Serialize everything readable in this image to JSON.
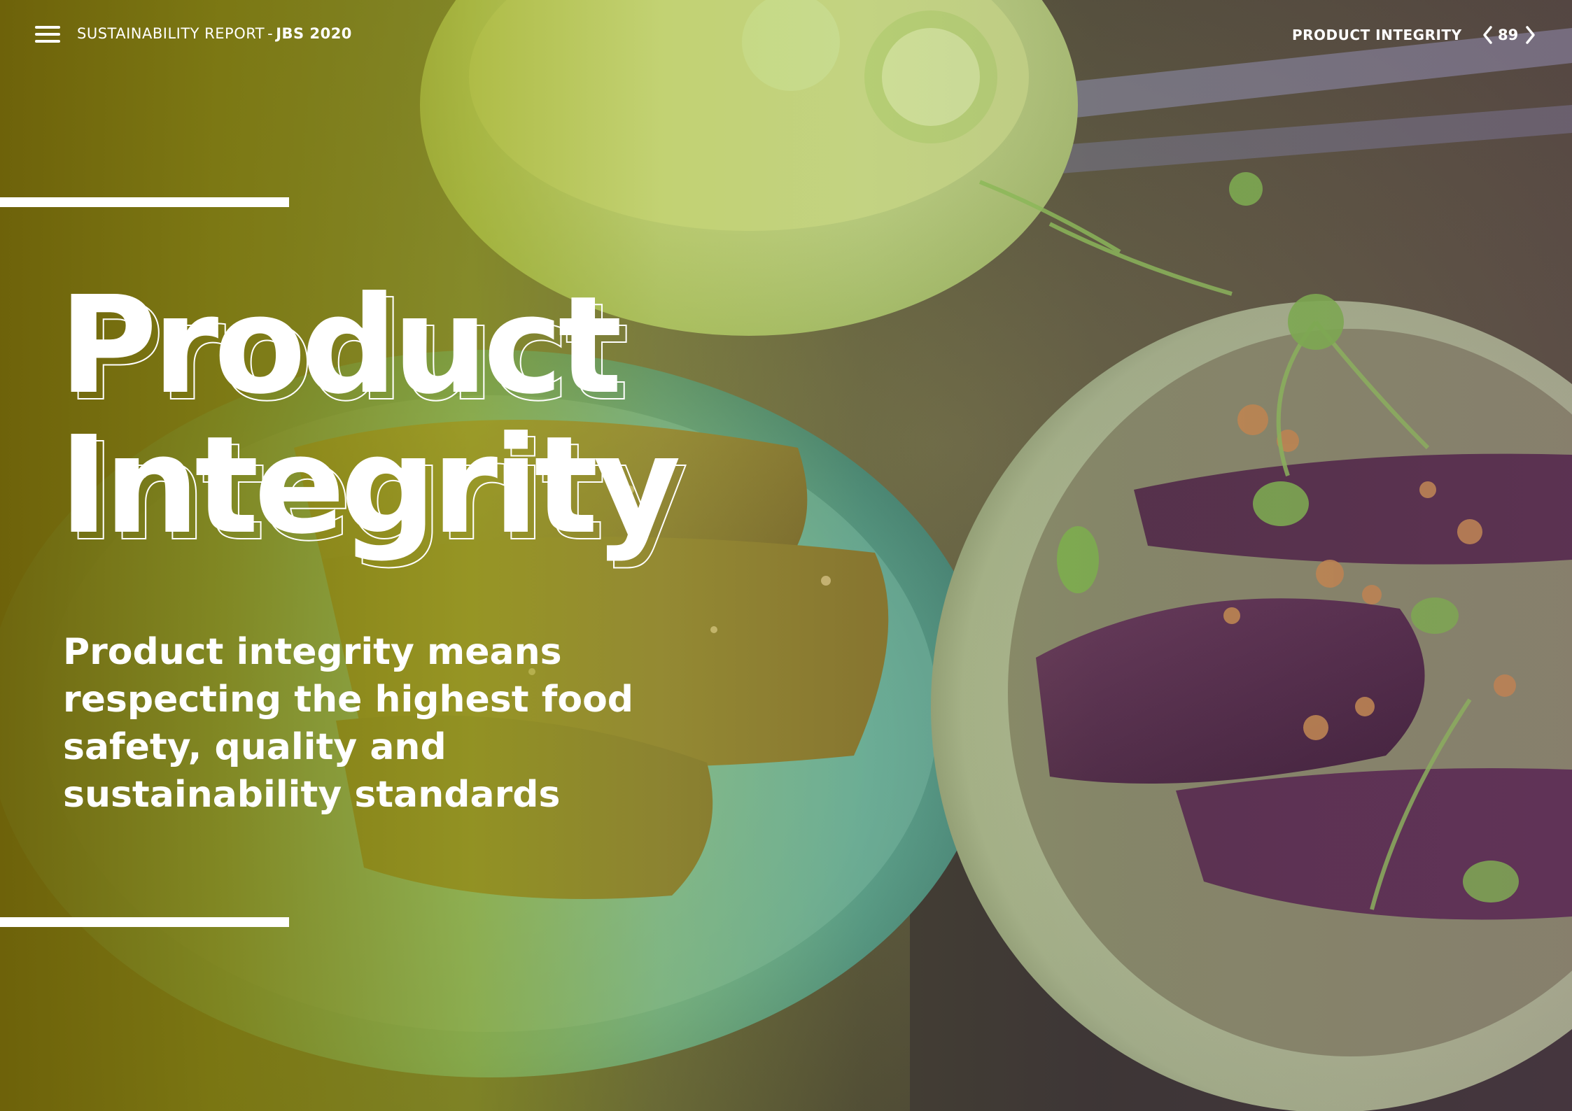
{
  "header": {
    "report_label": "SUSTAINABILITY REPORT",
    "separator": "-",
    "report_brand": "JBS 2020",
    "section_name": "PRODUCT INTEGRITY",
    "page_number": "89",
    "menu_icon": "hamburger-menu-icon",
    "prev_icon": "chevron-left-icon",
    "next_icon": "chevron-right-icon"
  },
  "hero": {
    "title_line1": "Product",
    "title_line2": "Integrity",
    "subtitle": "Product integrity means respecting the highest food safety, quality and sustainability standards"
  },
  "colors": {
    "overlay_left": "#706408",
    "overlay_mid": "#a0aa1e",
    "text": "#ffffff",
    "plate_teal": "#5fa79a",
    "bowl_sage": "#9fb48a"
  }
}
